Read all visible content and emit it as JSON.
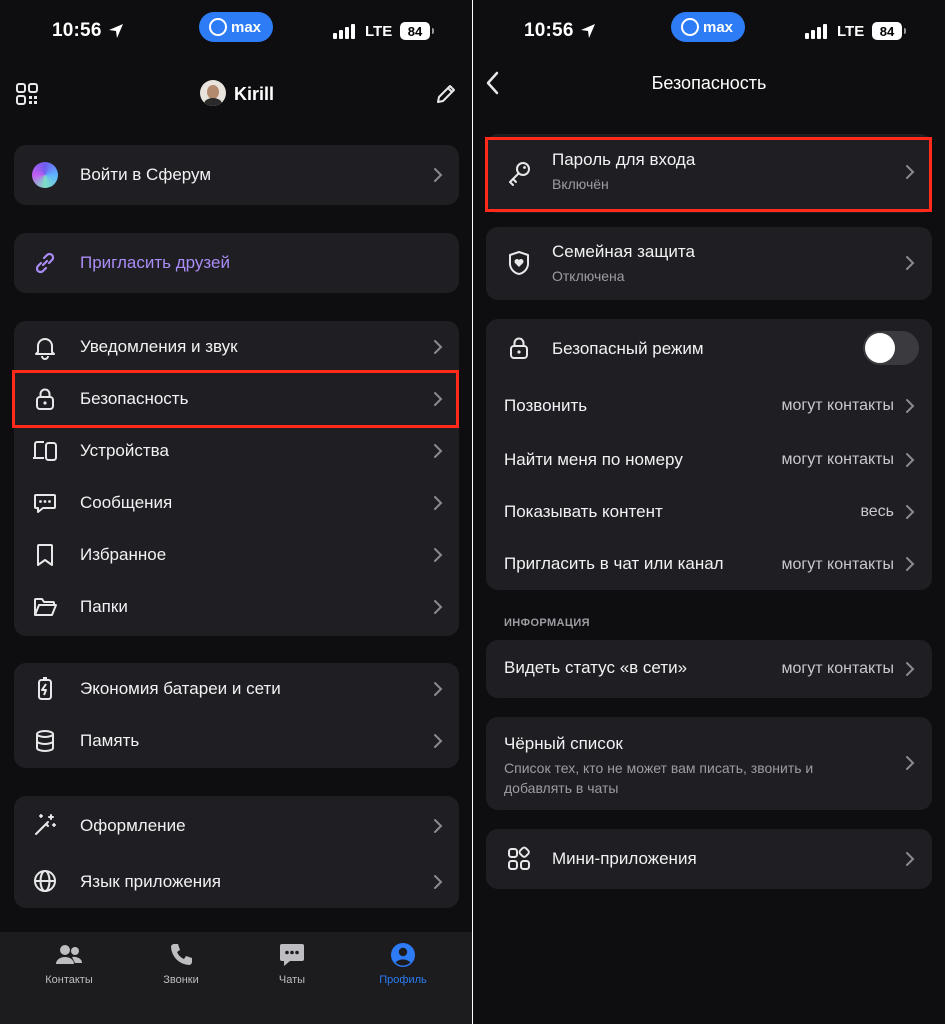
{
  "status_bar": {
    "time": "10:56",
    "app_badge": "max",
    "network": "LTE",
    "battery": "84"
  },
  "left": {
    "header": {
      "user_name": "Kirill"
    },
    "sferum": {
      "label": "Войти в Сферум"
    },
    "invite": {
      "label": "Пригласить друзей"
    },
    "menu_group_1": [
      {
        "label": "Уведомления и звук"
      },
      {
        "label": "Безопасность"
      },
      {
        "label": "Устройства"
      },
      {
        "label": "Сообщения"
      },
      {
        "label": "Избранное"
      },
      {
        "label": "Папки"
      }
    ],
    "menu_group_2": [
      {
        "label": "Экономия батареи и сети"
      },
      {
        "label": "Память"
      }
    ],
    "menu_group_3": [
      {
        "label": "Оформление"
      },
      {
        "label": "Язык приложения"
      }
    ],
    "tabs": [
      {
        "label": "Контакты"
      },
      {
        "label": "Звонки"
      },
      {
        "label": "Чаты"
      },
      {
        "label": "Профиль"
      }
    ]
  },
  "right": {
    "header": {
      "title": "Безопасность"
    },
    "password": {
      "label": "Пароль для входа",
      "status": "Включён"
    },
    "family": {
      "label": "Семейная защита",
      "status": "Отключена"
    },
    "safe_mode": {
      "label": "Безопасный режим",
      "enabled": false
    },
    "privacy_rows": [
      {
        "label": "Позвонить",
        "value": "могут контакты"
      },
      {
        "label": "Найти меня по номеру",
        "value": "могут контакты"
      },
      {
        "label": "Показывать контент",
        "value": "весь"
      },
      {
        "label": "Пригласить в чат или канал",
        "value": "могут контакты"
      }
    ],
    "info_section": {
      "title": "ИНФОРМАЦИЯ"
    },
    "online_status": {
      "label": "Видеть статус «в сети»",
      "value": "могут контакты"
    },
    "blacklist": {
      "label": "Чёрный список",
      "description_line1": "Список тех, кто не может вам писать, звонить и",
      "description_line2": "добавлять в чаты"
    },
    "mini_apps": {
      "label": "Мини-приложения"
    }
  },
  "colors": {
    "background": "#0e0e10",
    "card": "#1f1f23",
    "accent": "#2d7cf6",
    "invite": "#a98cf5",
    "highlight": "#ff2a1a"
  }
}
